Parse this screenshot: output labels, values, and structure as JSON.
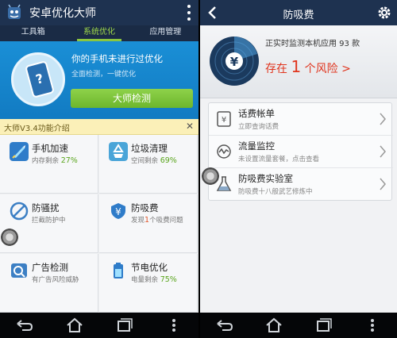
{
  "left": {
    "app_title": "安卓优化大师",
    "tabs": [
      {
        "label": "工具箱",
        "active": false
      },
      {
        "label": "系统优化",
        "active": true
      },
      {
        "label": "应用管理",
        "active": false
      }
    ],
    "hero": {
      "title": "你的手机未进行过优化",
      "subtitle": "全面检测，一键优化",
      "check_button": "大师检测"
    },
    "banner": {
      "text": "大师V3.4功能介绍",
      "close": "✕"
    },
    "tools": [
      {
        "name": "手机加速",
        "desc_prefix": "内存剩余",
        "desc_value": "27%",
        "desc_suffix": "",
        "icon": "rocket-icon"
      },
      {
        "name": "垃圾清理",
        "desc_prefix": "空间剩余",
        "desc_value": "69%",
        "desc_suffix": "",
        "icon": "recycle-icon"
      },
      {
        "name": "防骚扰",
        "desc_prefix": "拦截防护中",
        "desc_value": "",
        "desc_suffix": "",
        "icon": "block-icon"
      },
      {
        "name": "防吸费",
        "desc_prefix": "发现",
        "desc_value": "1",
        "desc_suffix": "个吸费问题",
        "icon": "shield-yuan-icon"
      },
      {
        "name": "广告检测",
        "desc_prefix": "有广告风险威胁",
        "desc_value": "",
        "desc_suffix": "",
        "icon": "ad-search-icon"
      },
      {
        "name": "节电优化",
        "desc_prefix": "电量剩余",
        "desc_value": "75%",
        "desc_suffix": "",
        "icon": "battery-icon"
      }
    ]
  },
  "right": {
    "title": "防吸费",
    "status_text": "正实时监测本机应用 93 款",
    "risk_prefix": "存在",
    "risk_count": "1",
    "risk_suffix": "个风险 >",
    "radar_symbol": "¥",
    "items": [
      {
        "name": "话费帐单",
        "desc": "立即查询话费",
        "icon": "bill-icon"
      },
      {
        "name": "流量监控",
        "desc": "未设置流量套餐，点击查看",
        "icon": "traffic-monitor-icon"
      },
      {
        "name": "防吸费实验室",
        "desc": "防吸费十八般武艺修炼中",
        "icon": "lab-flask-icon"
      }
    ]
  },
  "colors": {
    "titlebar": "#1e3250",
    "tab_active": "#8cc63f",
    "hero_blue": "#1a8fd6",
    "button_green": "#7ac43a",
    "risk_red": "#e0351e",
    "banner_yellow": "#fbf0b8"
  }
}
